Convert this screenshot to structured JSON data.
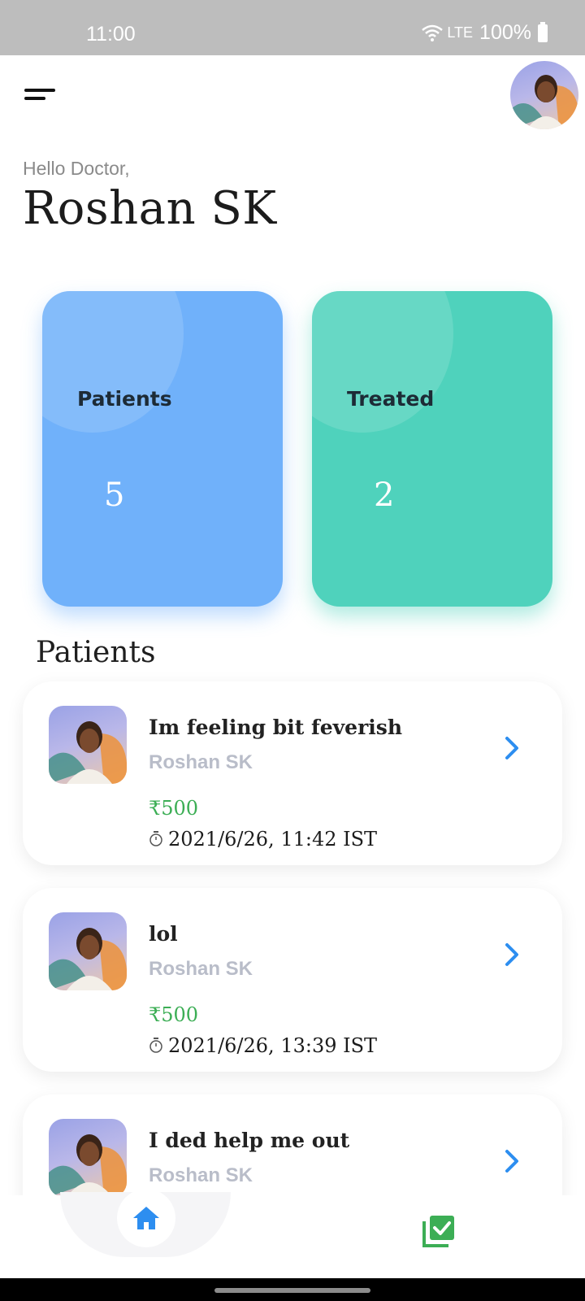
{
  "status_bar": {
    "time": "11:00",
    "network": "LTE",
    "battery": "100%"
  },
  "header": {
    "greeting": "Hello Doctor,",
    "doctor_name": "Roshan SK"
  },
  "stats": [
    {
      "label": "Patients",
      "value": "5",
      "color": "#70b1fa"
    },
    {
      "label": "Treated",
      "value": "2",
      "color": "#4fd2bc"
    }
  ],
  "section_title": "Patients",
  "patients": [
    {
      "title": "Im feeling bit feverish",
      "name": "Roshan SK",
      "price": "₹500",
      "time": "2021/6/26, 11:42 IST"
    },
    {
      "title": "lol",
      "name": "Roshan SK",
      "price": "₹500",
      "time": "2021/6/26, 13:39 IST"
    },
    {
      "title": "I ded help me out",
      "name": "Roshan SK",
      "price": "",
      "time": ""
    }
  ],
  "nav": {
    "items": [
      "home-icon",
      "checklist-icon"
    ],
    "accent": "#2d8ef0",
    "secondary": "#3cae55"
  }
}
